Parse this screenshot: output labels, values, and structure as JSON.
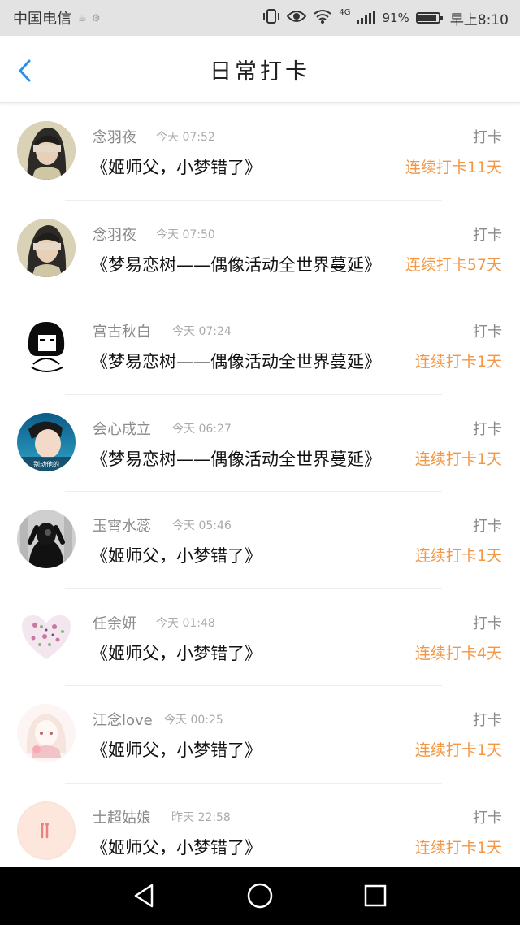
{
  "status_bar": {
    "carrier": "中国电信",
    "network": "4G",
    "battery_percent": "91%",
    "battery_level": 0.91,
    "time": "早上8:10"
  },
  "header": {
    "title": "日常打卡",
    "back_icon": "chevron-left-icon"
  },
  "colors": {
    "accent": "#f39745",
    "back_blue": "#2e8fe8"
  },
  "entries": [
    {
      "name": "念羽夜",
      "time": "今天 07:52",
      "book": "《姬师父，小梦错了》",
      "checkin": "打卡",
      "streak": "连续打卡11天",
      "avatar": "girl-photo"
    },
    {
      "name": "念羽夜",
      "time": "今天 07:50",
      "book": "《梦易恋树——偶像活动全世界蔓延》",
      "checkin": "打卡",
      "streak": "连续打卡57天",
      "avatar": "girl-photo"
    },
    {
      "name": "宫古秋白",
      "time": "今天 07:24",
      "book": "《梦易恋树——偶像活动全世界蔓延》",
      "checkin": "打卡",
      "streak": "连续打卡1天",
      "avatar": "ink-girl"
    },
    {
      "name": "会心成立",
      "time": "今天 06:27",
      "book": "《梦易恋树——偶像活动全世界蔓延》",
      "checkin": "打卡",
      "streak": "连续打卡1天",
      "avatar": "boy-photo",
      "avatar_caption": "别动他的"
    },
    {
      "name": "玉霄水蕊",
      "time": "今天 05:46",
      "book": "《姬师父，小梦错了》",
      "checkin": "打卡",
      "streak": "连续打卡1天",
      "avatar": "dark-figure"
    },
    {
      "name": "任余妍",
      "time": "今天 01:48",
      "book": "《姬师父，小梦错了》",
      "checkin": "打卡",
      "streak": "连续打卡4天",
      "avatar": "floral-heart"
    },
    {
      "name": "江念love",
      "time": "今天 00:25",
      "book": "《姬师父，小梦错了》",
      "checkin": "打卡",
      "streak": "连续打卡1天",
      "avatar": "anime-girl"
    },
    {
      "name": "士超姑娘",
      "time": "昨天 22:58",
      "book": "《姬师父，小梦错了》",
      "checkin": "打卡",
      "streak": "连续打卡1天",
      "avatar": "pink-circle"
    }
  ]
}
